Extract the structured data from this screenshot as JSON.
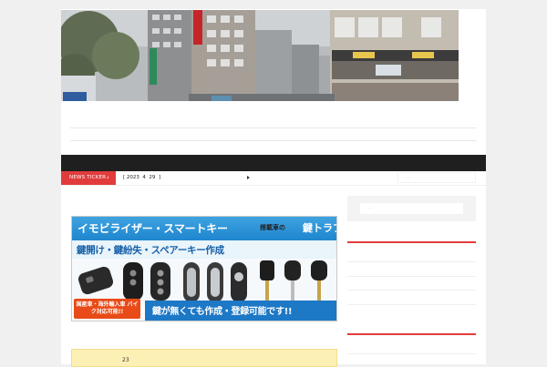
{
  "ticker": {
    "label": "NEWS TICKER",
    "chevron": "›",
    "text": "[ 2023  4  29  ]"
  },
  "search": {
    "top_placeholder": "...",
    "sidebar_placeholder": "..."
  },
  "banner": {
    "headline": "イモビライザー・スマートキー",
    "headline_small": "搭載車の",
    "headline_accent": "鍵トラブル",
    "subline": "鍵開け・鍵紛失・スペアーキー作成",
    "badge": "国産車・海外輸入車 バイク対応可能!!",
    "footer": "鍵が無くても作成・登録可能です!!"
  },
  "post": {
    "date_fragment": "23"
  },
  "colors": {
    "accent_red": "#e13c3c",
    "navbar": "#1f1f1f",
    "banner_blue": "#1f86cf",
    "banner_orange": "#e84b18",
    "notice_yellow": "#fdf0b5"
  }
}
